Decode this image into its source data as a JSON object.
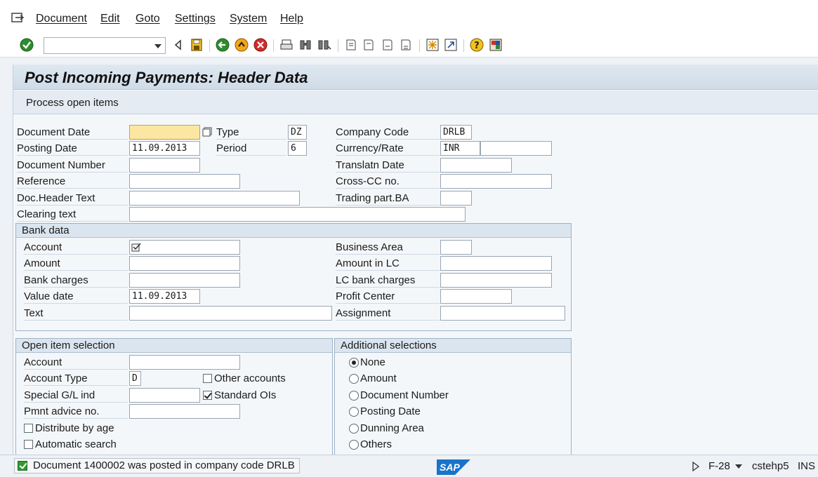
{
  "menu": [
    "Document",
    "Edit",
    "Goto",
    "Settings",
    "System",
    "Help"
  ],
  "toolbar": {
    "command_field_value": "",
    "icons": [
      "enter-icon",
      "back-arrow-icon",
      "save-icon",
      "back-icon",
      "exit-icon",
      "cancel-icon",
      "print-icon",
      "find-icon",
      "find-next-icon",
      "first-page-icon",
      "prev-page-icon",
      "next-page-icon",
      "last-page-icon",
      "new-session-icon",
      "shortcut-icon",
      "help-icon",
      "layout-icon"
    ]
  },
  "title": "Post Incoming Payments: Header Data",
  "app_toolbar": {
    "process_open_items": "Process open items"
  },
  "header": {
    "document_date": {
      "label": "Document Date",
      "value": ""
    },
    "type": {
      "label": "Type",
      "value": "DZ"
    },
    "company_code": {
      "label": "Company Code",
      "value": "DRLB"
    },
    "posting_date": {
      "label": "Posting Date",
      "value": "11.09.2013"
    },
    "period": {
      "label": "Period",
      "value": "6"
    },
    "currency_rate": {
      "label": "Currency/Rate",
      "value": "INR",
      "rate": ""
    },
    "document_number": {
      "label": "Document Number",
      "value": ""
    },
    "translatn_date": {
      "label": "Translatn Date",
      "value": ""
    },
    "reference": {
      "label": "Reference",
      "value": ""
    },
    "cross_cc": {
      "label": "Cross-CC no.",
      "value": ""
    },
    "doc_header_text": {
      "label": "Doc.Header Text",
      "value": ""
    },
    "trading_part_ba": {
      "label": "Trading part.BA",
      "value": ""
    },
    "clearing_text": {
      "label": "Clearing text",
      "value": ""
    }
  },
  "bank_data": {
    "title": "Bank data",
    "account": {
      "label": "Account",
      "value": ""
    },
    "business_area": {
      "label": "Business Area",
      "value": ""
    },
    "amount": {
      "label": "Amount",
      "value": ""
    },
    "amount_in_lc": {
      "label": "Amount in LC",
      "value": ""
    },
    "bank_charges": {
      "label": "Bank charges",
      "value": ""
    },
    "lc_bank_charges": {
      "label": "LC bank charges",
      "value": ""
    },
    "value_date": {
      "label": "Value date",
      "value": "11.09.2013"
    },
    "profit_center": {
      "label": "Profit Center",
      "value": ""
    },
    "text": {
      "label": "Text",
      "value": ""
    },
    "assignment": {
      "label": "Assignment",
      "value": ""
    }
  },
  "open_item_selection": {
    "title": "Open item selection",
    "account": {
      "label": "Account",
      "value": ""
    },
    "account_type": {
      "label": "Account Type",
      "value": "D"
    },
    "other_accounts": {
      "label": "Other accounts",
      "checked": false
    },
    "special_gl_ind": {
      "label": "Special G/L ind",
      "value": ""
    },
    "standard_ois": {
      "label": "Standard OIs",
      "checked": true
    },
    "pmnt_advice_no": {
      "label": "Pmnt advice no.",
      "value": ""
    },
    "distribute_by_age": {
      "label": "Distribute by age",
      "checked": false
    },
    "automatic_search": {
      "label": "Automatic search",
      "checked": false
    }
  },
  "additional_selections": {
    "title": "Additional selections",
    "options": [
      "None",
      "Amount",
      "Document Number",
      "Posting Date",
      "Dunning Area",
      "Others"
    ],
    "selected": "None"
  },
  "status_bar": {
    "message": "Document 1400002 was posted in company code DRLB",
    "logo_text": "SAP",
    "transaction": "F-28",
    "server": "cstehp5",
    "mode": "INS"
  },
  "colors": {
    "title_bg": "#cfdbe7",
    "focus_field": "#fbe7a1",
    "ok_green": "#2f9a2f",
    "sap_blue": "#1a73c8"
  }
}
